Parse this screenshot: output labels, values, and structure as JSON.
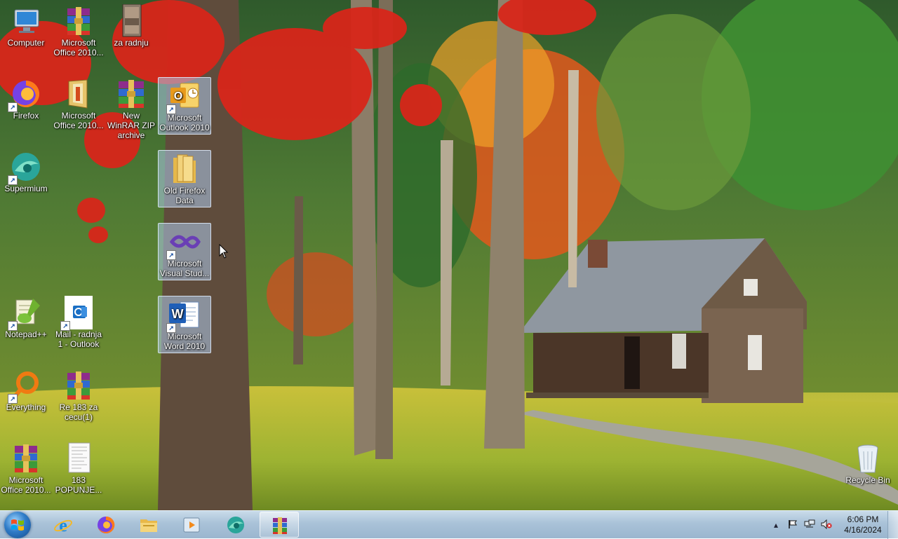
{
  "desktop": {
    "icons": [
      {
        "label": "Computer",
        "icon": "computer-icon"
      },
      {
        "label": "Microsoft Office 2010...",
        "icon": "winrar-archive-icon"
      },
      {
        "label": "za radnju",
        "icon": "document-thumbnail-icon"
      },
      {
        "label": "Firefox",
        "icon": "firefox-icon"
      },
      {
        "label": "Microsoft Office 2010...",
        "icon": "office-setup-icon"
      },
      {
        "label": "New WinRAR ZIP archive",
        "icon": "winrar-zip-icon"
      },
      {
        "label": "Microsoft Outlook 2010",
        "icon": "outlook-icon"
      },
      {
        "label": "Supermium",
        "icon": "supermium-icon"
      },
      {
        "label": "Old Firefox Data",
        "icon": "folder-icon"
      },
      {
        "label": "Microsoft Visual Stud...",
        "icon": "visual-studio-icon"
      },
      {
        "label": "Notepad++",
        "icon": "notepadpp-icon"
      },
      {
        "label": "Mail - radnja 1 - Outlook",
        "icon": "outlook-mail-icon"
      },
      {
        "label": "Microsoft Word 2010",
        "icon": "word-icon"
      },
      {
        "label": "Everything",
        "icon": "everything-search-icon"
      },
      {
        "label": "Re 183 za cecu(1)",
        "icon": "winrar-archive-icon"
      },
      {
        "label": "Microsoft Office 2010...",
        "icon": "winrar-archive-icon"
      },
      {
        "label": "183 POPUNJE...",
        "icon": "document-icon"
      },
      {
        "label": "Recycle Bin",
        "icon": "recycle-bin-icon"
      }
    ]
  },
  "taskbar": {
    "start": {
      "icon": "windows-logo-icon"
    },
    "pinned": [
      {
        "icon": "internet-explorer-icon"
      },
      {
        "icon": "firefox-icon"
      },
      {
        "icon": "file-explorer-icon"
      },
      {
        "icon": "media-player-icon"
      },
      {
        "icon": "supermium-icon"
      },
      {
        "icon": "winrar-icon",
        "active": true
      }
    ],
    "tray": {
      "icons": [
        "show-hidden-icons-chevron-icon",
        "action-center-flag-icon",
        "network-icon",
        "volume-muted-icon"
      ],
      "time": "6:06 PM",
      "date": "4/16/2024"
    }
  },
  "colors": {
    "taskbar": "#a9c2d8",
    "selection": "#adcbeb"
  }
}
